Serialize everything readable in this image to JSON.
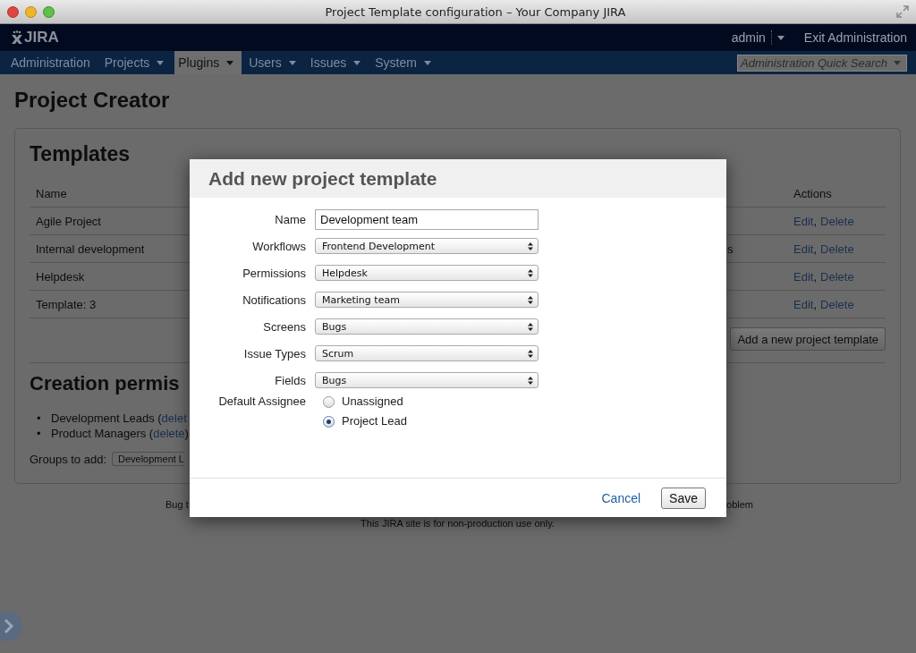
{
  "window": {
    "title": "Project Template configuration – Your Company JIRA"
  },
  "header": {
    "logo": "JIRA",
    "user": "admin",
    "exit": "Exit Administration"
  },
  "nav": {
    "items": [
      {
        "label": "Administration",
        "dropdown": false,
        "selected": false
      },
      {
        "label": "Projects",
        "dropdown": true,
        "selected": false
      },
      {
        "label": "Plugins",
        "dropdown": true,
        "selected": true
      },
      {
        "label": "Users",
        "dropdown": true,
        "selected": false
      },
      {
        "label": "Issues",
        "dropdown": true,
        "selected": false
      },
      {
        "label": "System",
        "dropdown": true,
        "selected": false
      }
    ],
    "search_placeholder": "Administration Quick Search"
  },
  "page_title": "Project Creator",
  "templates": {
    "heading": "Templates",
    "columns": [
      "Name",
      "Actions"
    ],
    "rows": [
      {
        "name": "Agile Project",
        "actions": [
          {
            "label": "Edit",
            "after": ","
          },
          {
            "label": "Delete"
          }
        ]
      },
      {
        "name": "Internal development",
        "column_2": "s",
        "actions": [
          {
            "label": "Edit",
            "after": ","
          },
          {
            "label": "Delete"
          }
        ]
      },
      {
        "name": "Helpdesk",
        "actions": [
          {
            "label": "Edit",
            "after": ","
          },
          {
            "label": "Delete"
          }
        ]
      },
      {
        "name": "Template: 3",
        "actions": [
          {
            "label": "Edit",
            "after": ","
          },
          {
            "label": "Delete"
          }
        ]
      }
    ],
    "add_button": "Add a new project template"
  },
  "permissions": {
    "heading": "Creation permis",
    "groups": [
      {
        "bullet": "•",
        "name": "Development Leads (",
        "link": "delet"
      },
      {
        "bullet": "•",
        "name": "Product Managers (",
        "link": "delete",
        "after": ")"
      }
    ],
    "add_label": "Groups to add:",
    "add_value": "Development L"
  },
  "footer": {
    "left": "Bug t",
    "right": "oblem",
    "notice": "This JIRA site is for non-production use only."
  },
  "dialog": {
    "title": "Add new project template",
    "fields": [
      {
        "label": "Name",
        "kind": "text",
        "value": "Development team"
      },
      {
        "label": "Workflows",
        "kind": "select",
        "value": "Frontend Development"
      },
      {
        "label": "Permissions",
        "kind": "select",
        "value": "Helpdesk"
      },
      {
        "label": "Notifications",
        "kind": "select",
        "value": "Marketing team"
      },
      {
        "label": "Screens",
        "kind": "select",
        "value": "Bugs"
      },
      {
        "label": "Issue Types",
        "kind": "select",
        "value": "Scrum"
      },
      {
        "label": "Fields",
        "kind": "select",
        "value": "Bugs"
      }
    ],
    "assignee": {
      "label": "Default Assignee",
      "options": [
        {
          "label": "Unassigned",
          "selected": false
        },
        {
          "label": "Project Lead",
          "selected": true
        }
      ]
    },
    "cancel": "Cancel",
    "save": "Save"
  }
}
